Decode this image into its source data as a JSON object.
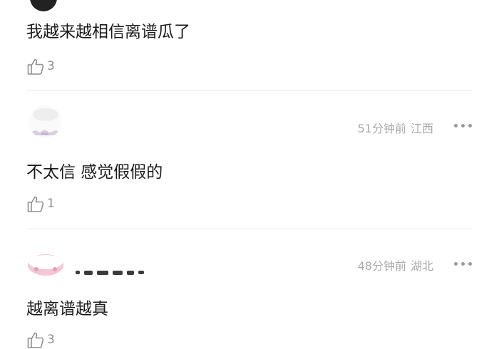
{
  "comments": [
    {
      "text": "我越来越相信离谱瓜了",
      "likes": "3"
    },
    {
      "time": "51分钟前",
      "location": "江西",
      "text": "不太信  感觉假假的",
      "likes": "1"
    },
    {
      "time": "48分钟前",
      "location": "湖北",
      "text": "越离谱越真",
      "likes": "3"
    }
  ],
  "icons": {
    "like": "thumbs-up-icon",
    "more": "more-dots-icon"
  },
  "colors": {
    "text": "#1b1b1b",
    "meta": "#a9a9a9",
    "icon": "#8f8f8f",
    "divider": "#ececec"
  }
}
